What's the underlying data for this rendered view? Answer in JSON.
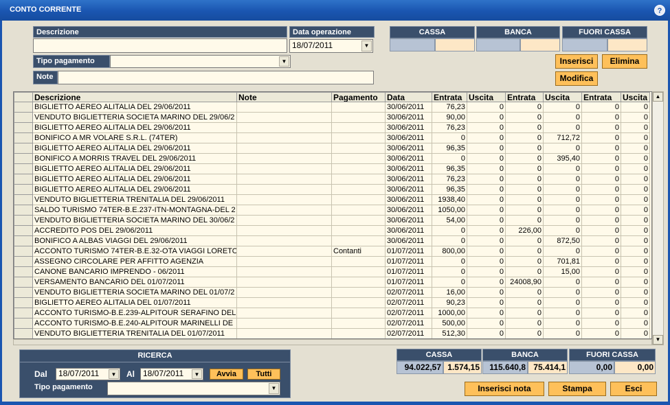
{
  "window": {
    "title": "CONTO CORRENTE",
    "help": "?"
  },
  "form": {
    "descrizione_label": "Descrizione",
    "descrizione_value": "",
    "data_operazione_label": "Data operazione",
    "data_operazione_value": "18/07/2011",
    "tipo_pagamento_label": "Tipo pagamento",
    "tipo_pagamento_value": "",
    "note_label": "Note",
    "note_value": ""
  },
  "summary_top": {
    "cassa": "CASSA",
    "banca": "BANCA",
    "fuori_cassa": "FUORI CASSA"
  },
  "buttons": {
    "inserisci": "Inserisci",
    "elimina": "Elimina",
    "modifica": "Modifica",
    "inserisci_nota": "Inserisci nota",
    "stampa": "Stampa",
    "esci": "Esci"
  },
  "table": {
    "columns": [
      "Descrizione",
      "Note",
      "Pagamento",
      "Data",
      "Entrata",
      "Uscita",
      "Entrata",
      "Uscita",
      "Entrata",
      "Uscita"
    ],
    "rows": [
      [
        "BIGLIETTO AEREO ALITALIA DEL 29/06/2011",
        "",
        "",
        "30/06/2011",
        "76,23",
        "0",
        "0",
        "0",
        "0",
        "0"
      ],
      [
        "VENDUTO BIGLIETTERIA SOCIETA MARINO DEL 29/06/2",
        "",
        "",
        "30/06/2011",
        "90,00",
        "0",
        "0",
        "0",
        "0",
        "0"
      ],
      [
        "BIGLIETTO AEREO ALITALIA DEL 29/06/2011",
        "",
        "",
        "30/06/2011",
        "76,23",
        "0",
        "0",
        "0",
        "0",
        "0"
      ],
      [
        "BONIFICO A MR VOLARE S.R.L. (74TER)",
        "",
        "",
        "30/06/2011",
        "0",
        "0",
        "0",
        "712,72",
        "0",
        "0"
      ],
      [
        "BIGLIETTO AEREO ALITALIA DEL 29/06/2011",
        "",
        "",
        "30/06/2011",
        "96,35",
        "0",
        "0",
        "0",
        "0",
        "0"
      ],
      [
        "BONIFICO A MORRIS TRAVEL DEL 29/06/2011",
        "",
        "",
        "30/06/2011",
        "0",
        "0",
        "0",
        "395,40",
        "0",
        "0"
      ],
      [
        "BIGLIETTO AEREO ALITALIA DEL 29/06/2011",
        "",
        "",
        "30/06/2011",
        "96,35",
        "0",
        "0",
        "0",
        "0",
        "0"
      ],
      [
        "BIGLIETTO AEREO ALITALIA DEL 29/06/2011",
        "",
        "",
        "30/06/2011",
        "76,23",
        "0",
        "0",
        "0",
        "0",
        "0"
      ],
      [
        "BIGLIETTO AEREO ALITALIA DEL 29/06/2011",
        "",
        "",
        "30/06/2011",
        "96,35",
        "0",
        "0",
        "0",
        "0",
        "0"
      ],
      [
        "VENDUTO BIGLIETTERIA TRENITALIA DEL 29/06/2011",
        "",
        "",
        "30/06/2011",
        "1938,40",
        "0",
        "0",
        "0",
        "0",
        "0"
      ],
      [
        "SALDO TURISMO 74TER-B.E.237-ITN-MONTAGNA-DEL 2",
        "",
        "",
        "30/06/2011",
        "1050,00",
        "0",
        "0",
        "0",
        "0",
        "0"
      ],
      [
        "VENDUTO BIGLIETTERIA SOCIETA MARINO DEL 30/06/2",
        "",
        "",
        "30/06/2011",
        "54,00",
        "0",
        "0",
        "0",
        "0",
        "0"
      ],
      [
        "ACCREDITO POS DEL 29/06/2011",
        "",
        "",
        "30/06/2011",
        "0",
        "0",
        "226,00",
        "0",
        "0",
        "0"
      ],
      [
        "BONIFICO A ALBAS VIAGGI DEL 29/06/2011",
        "",
        "",
        "30/06/2011",
        "0",
        "0",
        "0",
        "872,50",
        "0",
        "0"
      ],
      [
        "ACCONTO TURISMO 74TER-B.E.32-OTA VIAGGI LORETO",
        "",
        "Contanti",
        "01/07/2011",
        "800,00",
        "0",
        "0",
        "0",
        "0",
        "0"
      ],
      [
        "ASSEGNO CIRCOLARE PER AFFITTO AGENZIA",
        "",
        "",
        "01/07/2011",
        "0",
        "0",
        "0",
        "701,81",
        "0",
        "0"
      ],
      [
        "CANONE BANCARIO IMPRENDO - 06/2011",
        "",
        "",
        "01/07/2011",
        "0",
        "0",
        "0",
        "15,00",
        "0",
        "0"
      ],
      [
        "VERSAMENTO BANCARIO DEL 01/07/2011",
        "",
        "",
        "01/07/2011",
        "0",
        "0",
        "24008,90",
        "0",
        "0",
        "0"
      ],
      [
        "VENDUTO BIGLIETTERIA SOCIETA MARINO DEL 01/07/2",
        "",
        "",
        "02/07/2011",
        "16,00",
        "0",
        "0",
        "0",
        "0",
        "0"
      ],
      [
        "BIGLIETTO AEREO ALITALIA DEL 01/07/2011",
        "",
        "",
        "02/07/2011",
        "90,23",
        "0",
        "0",
        "0",
        "0",
        "0"
      ],
      [
        "ACCONTO TURISMO-B.E.239-ALPITOUR SERAFINO DEL",
        "",
        "",
        "02/07/2011",
        "1000,00",
        "0",
        "0",
        "0",
        "0",
        "0"
      ],
      [
        "ACCONTO TURISMO-B.E.240-ALPITOUR MARINELLI DE",
        "",
        "",
        "02/07/2011",
        "500,00",
        "0",
        "0",
        "0",
        "0",
        "0"
      ],
      [
        "VENDUTO BIGLIETTERIA TRENITALIA DEL 01/07/2011",
        "",
        "",
        "02/07/2011",
        "512,30",
        "0",
        "0",
        "0",
        "0",
        "0"
      ]
    ]
  },
  "ricerca": {
    "title": "RICERCA",
    "dal_label": "Dal",
    "dal_value": "18/07/2011",
    "al_label": "Al",
    "al_value": "18/07/2011",
    "avvia": "Avvia",
    "tutti": "Tutti",
    "tipo_pagamento_label": "Tipo pagamento",
    "tipo_pagamento_value": ""
  },
  "totals": {
    "cassa_label": "CASSA",
    "banca_label": "BANCA",
    "fuori_cassa_label": "FUORI CASSA",
    "cassa_entrata": "94.022,57",
    "cassa_uscita": "1.574,15",
    "banca_entrata": "115.640,8",
    "banca_uscita": "75.414,1",
    "fuori_entrata": "0,00",
    "fuori_uscita": "0,00"
  },
  "icons": {
    "combo_arrow": "▼",
    "scroll_up": "▲",
    "scroll_down": "▼"
  },
  "colors": {
    "titlebar": "#1a55b0",
    "label_bg": "#3a4f6b",
    "button": "#fec05a",
    "field": "#fffaea",
    "body": "#e4e0d2"
  }
}
